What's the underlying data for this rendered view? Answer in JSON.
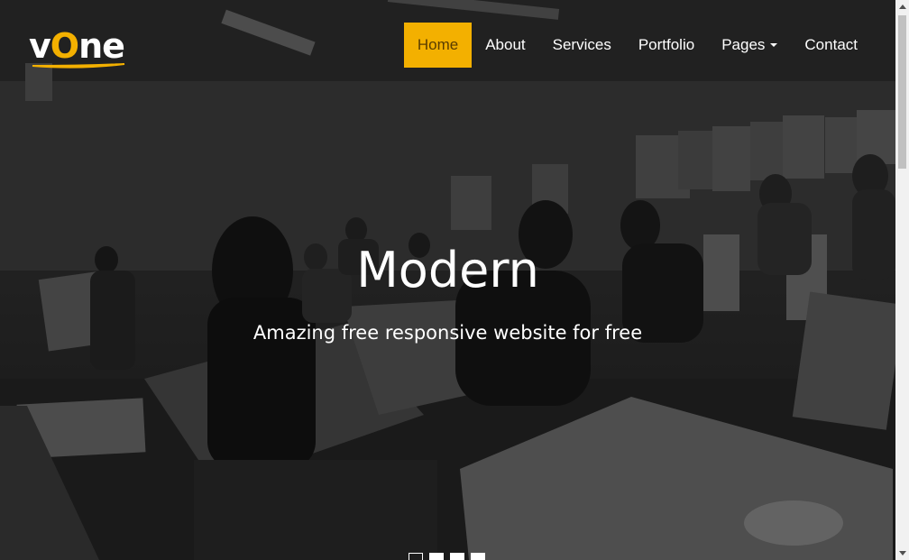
{
  "brand": {
    "logo_prefix": "v",
    "logo_o": "O",
    "logo_suffix": "ne",
    "accent_color": "#f3b000"
  },
  "nav": {
    "items": [
      {
        "label": "Home",
        "active": true
      },
      {
        "label": "About"
      },
      {
        "label": "Services"
      },
      {
        "label": "Portfolio"
      },
      {
        "label": "Pages",
        "dropdown": true
      },
      {
        "label": "Contact"
      }
    ]
  },
  "hero": {
    "title": "Modern",
    "subtitle": "Amazing free responsive website for free",
    "background": "art-classroom-photo"
  },
  "carousel": {
    "slide_count": 4,
    "active_index": 0
  },
  "icons": {
    "dropdown": "caret-down-icon",
    "scroll_up": "arrow-up-icon",
    "scroll_down": "arrow-down-icon"
  }
}
